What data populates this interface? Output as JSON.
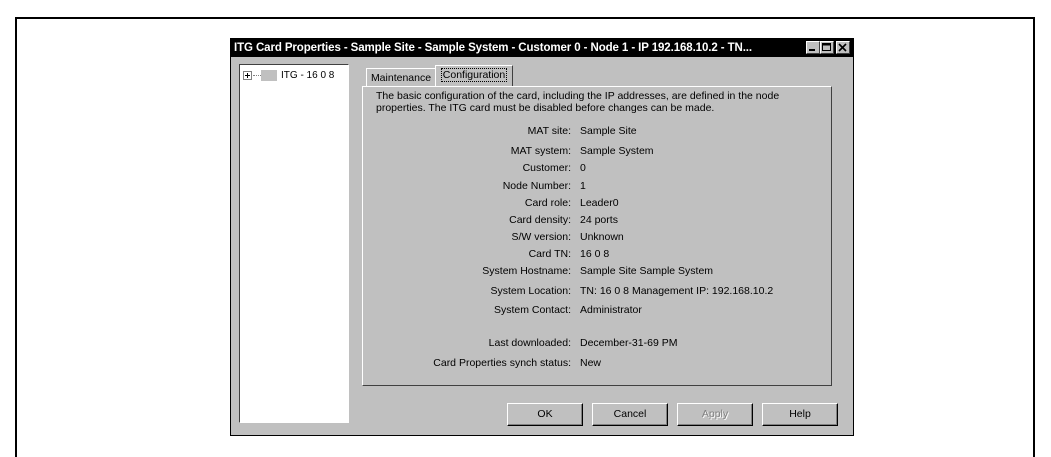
{
  "window": {
    "title": "ITG Card Properties - Sample Site - Sample System - Customer 0 - Node 1 - IP 192.168.10.2 - TN..."
  },
  "tree": {
    "items": [
      {
        "label": "ITG - 16 0 8",
        "expanded": false
      }
    ]
  },
  "tabs": [
    {
      "label": "Maintenance",
      "active": false
    },
    {
      "label": "Configuration",
      "active": true
    }
  ],
  "configuration": {
    "description": "The basic configuration of the card, including the IP addresses, are defined in the node properties.  The ITG card must be disabled before changes can be made.",
    "fields": [
      {
        "label": "MAT site:",
        "value": "Sample Site"
      },
      {
        "label": "MAT system:",
        "value": "Sample System"
      },
      {
        "label": "Customer:",
        "value": "0"
      },
      {
        "label": "Node Number:",
        "value": "1"
      },
      {
        "label": "Card role:",
        "value": "Leader0"
      },
      {
        "label": "Card density:",
        "value": "24 ports"
      },
      {
        "label": "S/W version:",
        "value": "Unknown"
      },
      {
        "label": "Card TN:",
        "value": "16 0 8"
      },
      {
        "label": "System Hostname:",
        "value": "Sample Site Sample System"
      },
      {
        "label": "System Location:",
        "value": "TN: 16 0 8 Management IP: 192.168.10.2"
      },
      {
        "label": "System Contact:",
        "value": "Administrator"
      },
      {
        "label": "Last downloaded:",
        "value": "December-31-69 PM"
      },
      {
        "label": "Card Properties synch status:",
        "value": "New"
      }
    ]
  },
  "buttons": {
    "ok": "OK",
    "cancel": "Cancel",
    "apply": "Apply",
    "apply_enabled": false,
    "help": "Help"
  }
}
